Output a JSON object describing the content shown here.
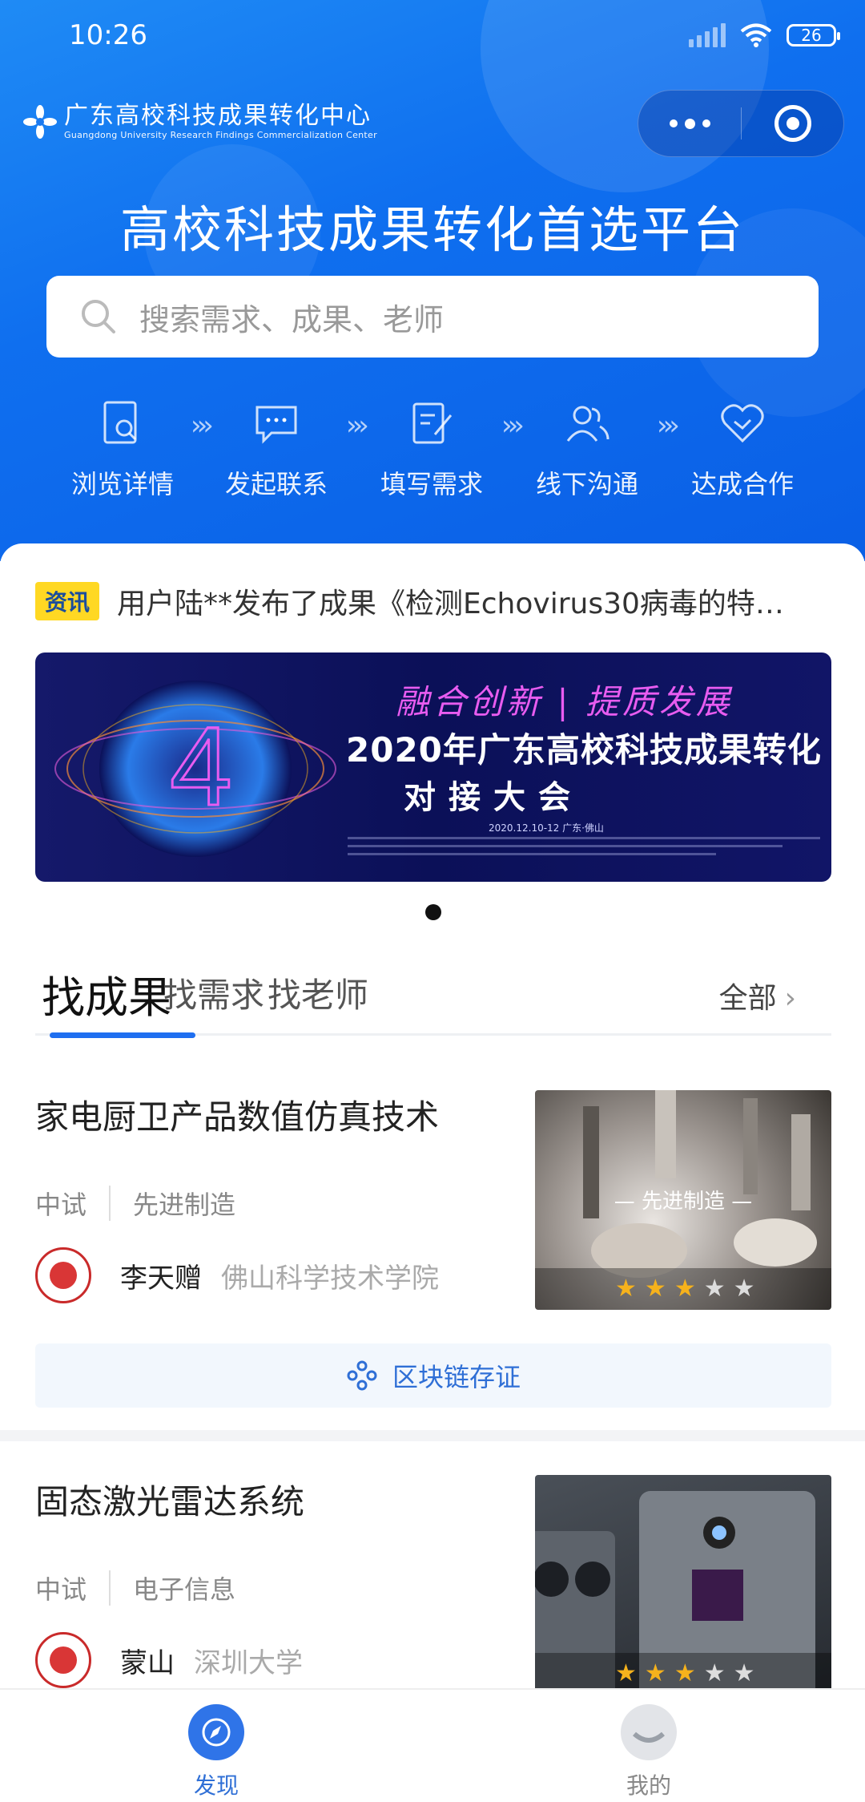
{
  "status_bar": {
    "time": "10:26",
    "battery": "26"
  },
  "header": {
    "logo_cn": "广东高校科技成果转化中心",
    "logo_en": "Guangdong University Research Findings Commercialization Center",
    "hero_title": "高校科技成果转化首选平台"
  },
  "search": {
    "placeholder": "搜索需求、成果、老师"
  },
  "steps": [
    {
      "label": "浏览详情",
      "icon": "document-search-icon"
    },
    {
      "label": "发起联系",
      "icon": "chat-bubble-icon"
    },
    {
      "label": "填写需求",
      "icon": "edit-form-icon"
    },
    {
      "label": "线下沟通",
      "icon": "users-icon"
    },
    {
      "label": "达成合作",
      "icon": "handshake-icon"
    }
  ],
  "news": {
    "badge": "资讯",
    "text": "用户陆**发布了成果《检测Echovirus30病毒的特…"
  },
  "banner": {
    "slogan": "融合创新 | 提质发展",
    "title": "2020年广东高校科技成果转化",
    "subtitle": "对接大会",
    "date": "2020.12.10-12 广东·佛山",
    "page_count": 1
  },
  "tabs": {
    "items": [
      "找成果",
      "找需求",
      "找老师"
    ],
    "active": 0,
    "all_label": "全部"
  },
  "results": [
    {
      "title": "家电厨卫产品数值仿真技术",
      "stage": "中试",
      "category": "先进制造",
      "author": "李天赠",
      "org": "佛山科学技术学院",
      "thumb_label": "— 先进制造 —",
      "rating": 3,
      "rating_max": 5,
      "chain_label": "区块链存证"
    },
    {
      "title": "固态激光雷达系统",
      "stage": "中试",
      "category": "电子信息",
      "author": "蒙山",
      "org": "深圳大学",
      "rating": 3,
      "rating_max": 5
    }
  ],
  "bottom_nav": [
    {
      "label": "发现",
      "active": true
    },
    {
      "label": "我的",
      "active": false
    }
  ],
  "colors": {
    "primary": "#1f6ff0",
    "badge_bg": "#ffd823",
    "star": "#f6b21c"
  }
}
